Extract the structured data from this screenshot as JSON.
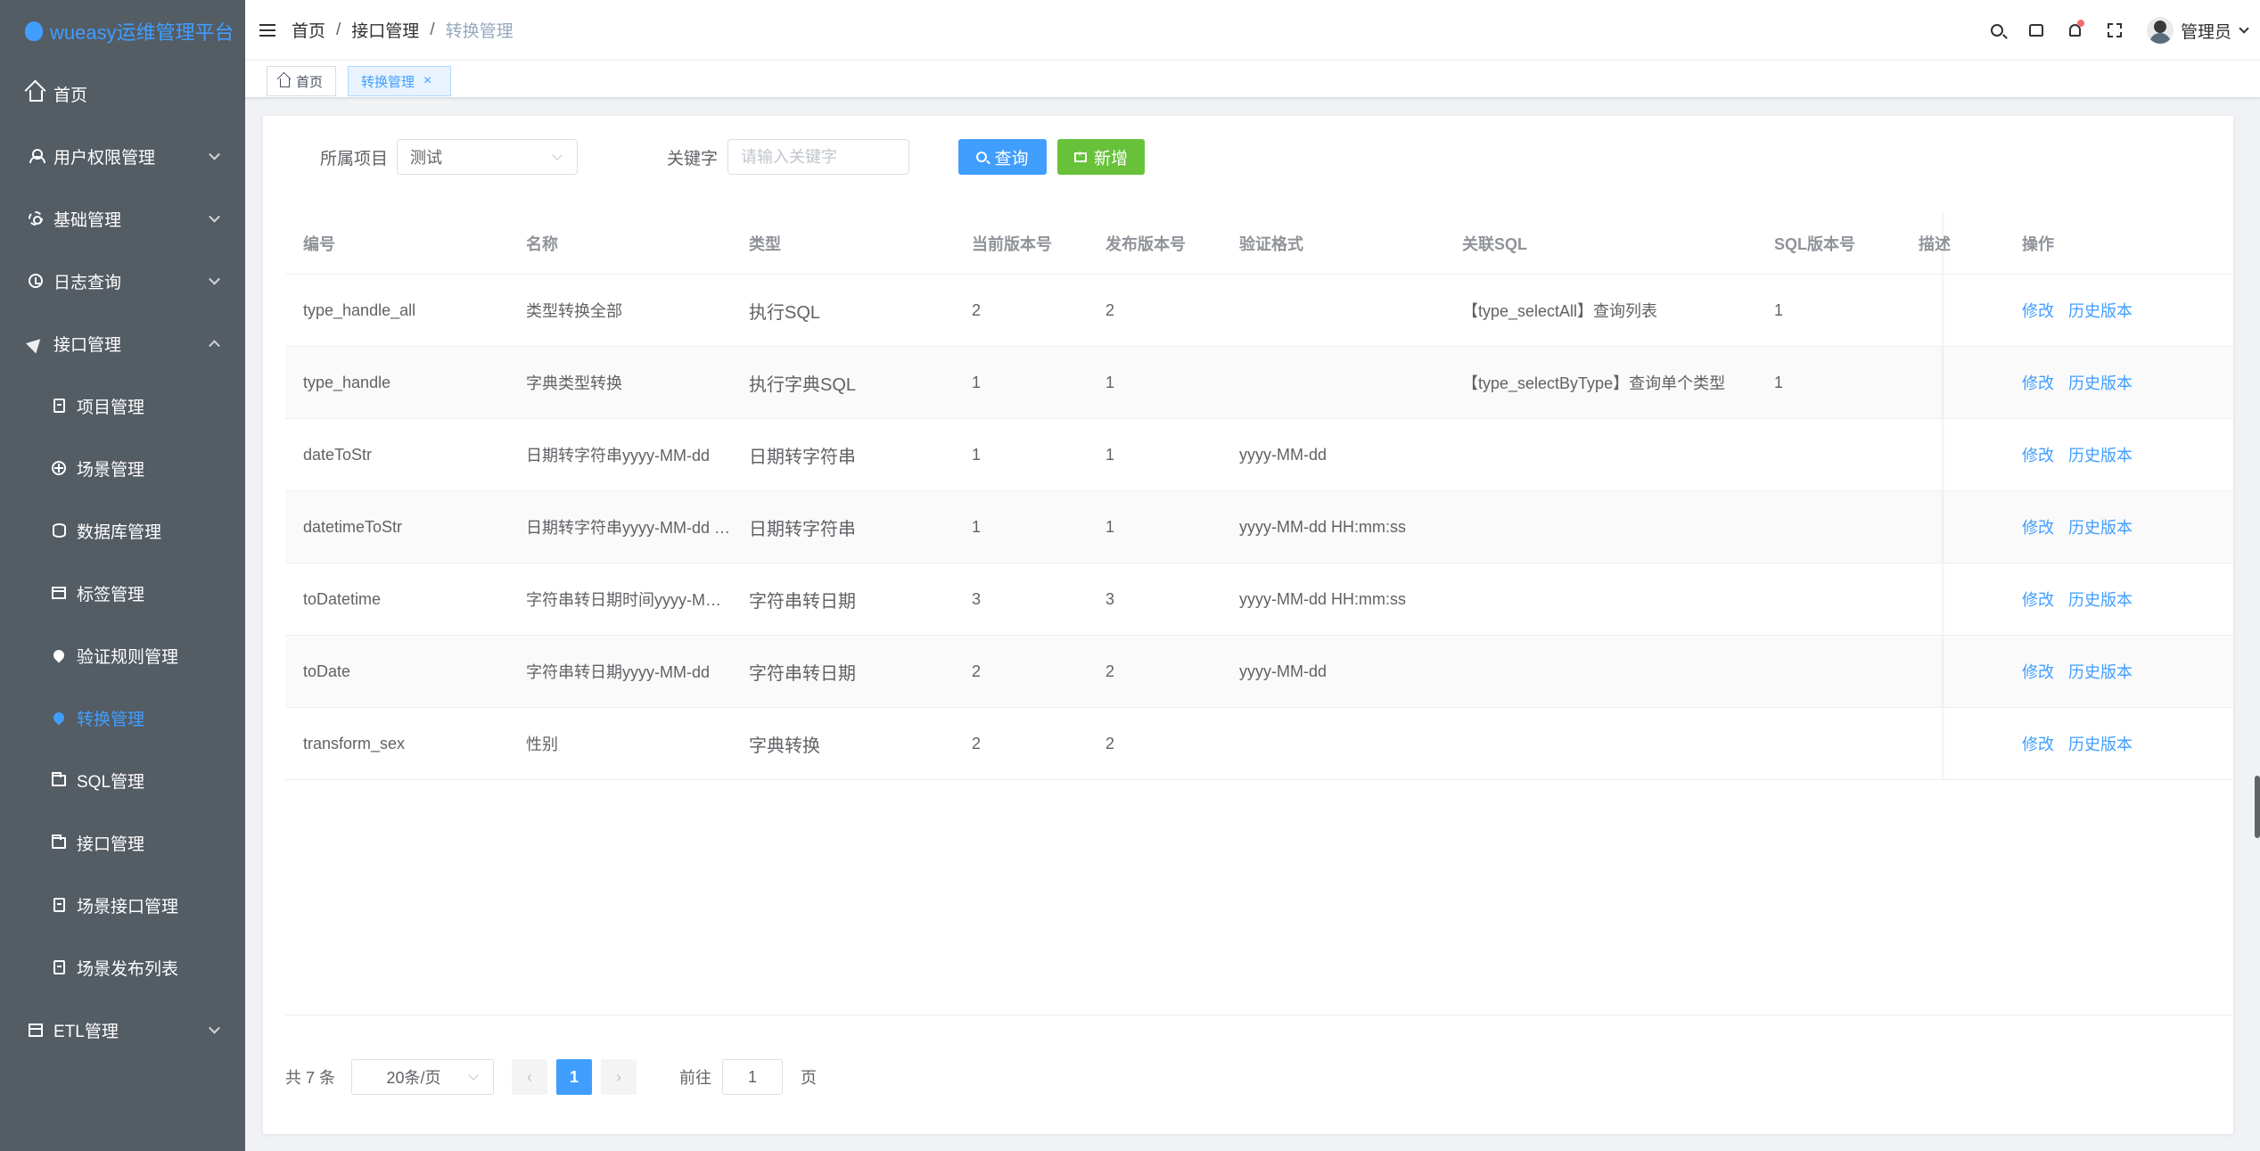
{
  "app": {
    "title": "wueasy运维管理平台",
    "brand_color": "#409eff",
    "sidebar_bg": "#545c64"
  },
  "sidebar": {
    "items": [
      {
        "label": "首页",
        "icon": "home-icon",
        "level": 1,
        "expandable": false
      },
      {
        "label": "用户权限管理",
        "icon": "user-icon",
        "level": 1,
        "expandable": true
      },
      {
        "label": "基础管理",
        "icon": "gear-icon",
        "level": 1,
        "expandable": true
      },
      {
        "label": "日志查询",
        "icon": "clock-icon",
        "level": 1,
        "expandable": true
      },
      {
        "label": "接口管理",
        "icon": "send-icon",
        "level": 1,
        "expandable": true,
        "expanded": true
      },
      {
        "label": "项目管理",
        "icon": "clipboard-icon",
        "level": 2
      },
      {
        "label": "场景管理",
        "icon": "circle-plus-icon",
        "level": 2
      },
      {
        "label": "数据库管理",
        "icon": "database-icon",
        "level": 2
      },
      {
        "label": "标签管理",
        "icon": "box-icon",
        "level": 2
      },
      {
        "label": "验证规则管理",
        "icon": "drop-icon",
        "level": 2
      },
      {
        "label": "转换管理",
        "icon": "drop-icon",
        "level": 2,
        "active": true
      },
      {
        "label": "SQL管理",
        "icon": "folder-icon",
        "level": 2
      },
      {
        "label": "接口管理",
        "icon": "folder-icon",
        "level": 2
      },
      {
        "label": "场景接口管理",
        "icon": "copy-icon",
        "level": 2
      },
      {
        "label": "场景发布列表",
        "icon": "doc-icon",
        "level": 2
      },
      {
        "label": "ETL管理",
        "icon": "calendar-icon",
        "level": 1,
        "expandable": true
      }
    ]
  },
  "header": {
    "breadcrumb": [
      "首页",
      "接口管理",
      "转换管理"
    ],
    "breadcrumb_sep": "/",
    "user_name": "管理员"
  },
  "tags": {
    "home": "首页",
    "active": "转换管理",
    "close_glyph": "×"
  },
  "filters": {
    "project_label": "所属项目",
    "project_value": "测试",
    "keyword_label": "关键字",
    "keyword_placeholder": "请输入关键字",
    "query_label": "查询",
    "add_label": "新增"
  },
  "table": {
    "columns": [
      "编号",
      "名称",
      "类型",
      "当前版本号",
      "发布版本号",
      "验证格式",
      "关联SQL",
      "SQL版本号",
      "描述",
      "操作"
    ],
    "rows": [
      [
        "type_handle_all",
        "类型转换全部",
        "执行SQL",
        "2",
        "2",
        "",
        "【type_selectAll】查询列表",
        "1",
        ""
      ],
      [
        "type_handle",
        "字典类型转换",
        "执行字典SQL",
        "1",
        "1",
        "",
        "【type_selectByType】查询单个类型",
        "1",
        ""
      ],
      [
        "dateToStr",
        "日期转字符串yyyy-MM-dd",
        "日期转字符串",
        "1",
        "1",
        "yyyy-MM-dd",
        "",
        "",
        ""
      ],
      [
        "datetimeToStr",
        "日期转字符串yyyy-MM-dd HH:mm:ss",
        "日期转字符串",
        "1",
        "1",
        "yyyy-MM-dd HH:mm:ss",
        "",
        "",
        ""
      ],
      [
        "toDatetime",
        "字符串转日期时间yyyy-MM-dd HH:mm:ss",
        "字符串转日期",
        "3",
        "3",
        "yyyy-MM-dd HH:mm:ss",
        "",
        "",
        ""
      ],
      [
        "toDate",
        "字符串转日期yyyy-MM-dd",
        "字符串转日期",
        "2",
        "2",
        "yyyy-MM-dd",
        "",
        "",
        ""
      ],
      [
        "transform_sex",
        "性别",
        "字典转换",
        "2",
        "2",
        "",
        "",
        "",
        ""
      ]
    ],
    "actions": {
      "edit": "修改",
      "history": "历史版本"
    }
  },
  "pagination": {
    "total_text": "共 7 条",
    "page_size": "20条/页",
    "prev_glyph": "‹",
    "next_glyph": "›",
    "current_page": "1",
    "goto_label": "前往",
    "goto_value": "1",
    "page_suffix": "页"
  }
}
